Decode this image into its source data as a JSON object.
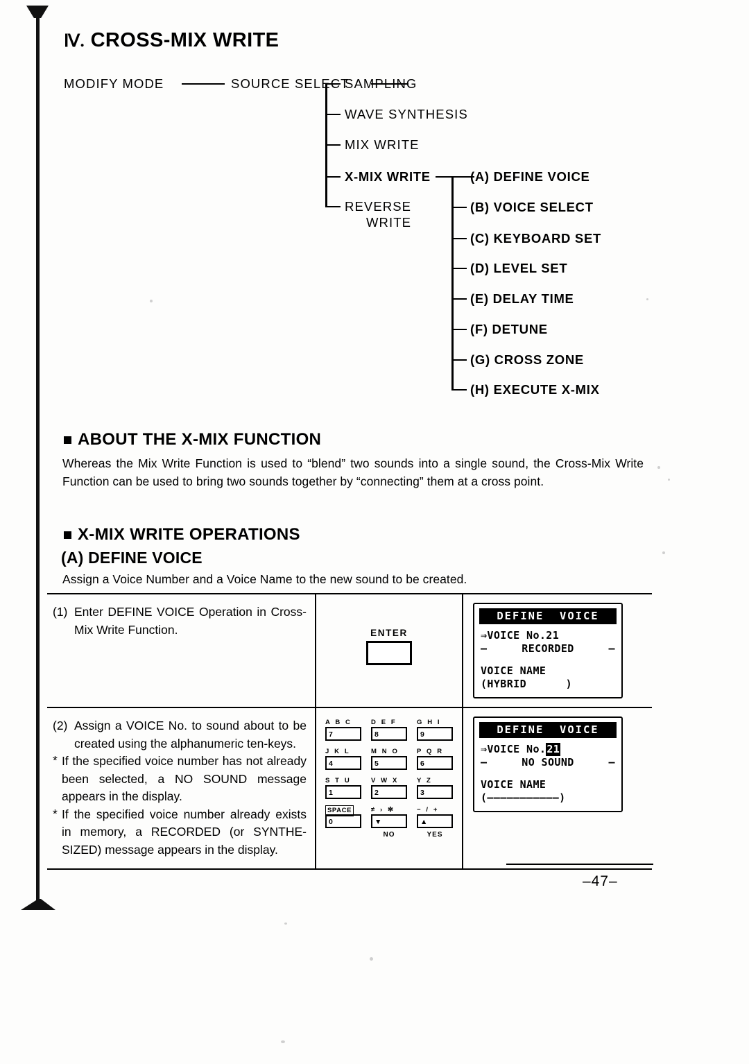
{
  "document": {
    "title_numeral": "Ⅳ.",
    "title": "CROSS-MIX WRITE",
    "page_number": "–47–"
  },
  "tree": {
    "root": "MODIFY MODE",
    "level2": "SOURCE SELECT",
    "branches": [
      "SAMPLING",
      "WAVE SYNTHESIS",
      "MIX WRITE",
      "X-MIX WRITE",
      "REVERSE"
    ],
    "reverse_second_line": "WRITE",
    "submenu": [
      "(A) DEFINE VOICE",
      "(B) VOICE SELECT",
      "(C) KEYBOARD SET",
      "(D) LEVEL SET",
      "(E) DELAY TIME",
      "(F) DETUNE",
      "(G) CROSS ZONE",
      "(H) EXECUTE X-MIX"
    ]
  },
  "about": {
    "heading": "ABOUT THE X-MIX FUNCTION",
    "paragraph": "Whereas the Mix Write Function is used to “blend” two sounds into a single sound, the Cross-Mix Write Function can be used to bring two sounds together by “connecting” them at a cross point."
  },
  "operations": {
    "heading": "X-MIX WRITE OPERATIONS",
    "subheading": "(A) DEFINE VOICE",
    "intro": "Assign a Voice Number and a Voice Name to the new sound to be created."
  },
  "steps": [
    {
      "number": "(1)",
      "text": "Enter DEFINE VOICE Operation in Cross-Mix Write Function.",
      "notes": []
    },
    {
      "number": "(2)",
      "text": "Assign a VOICE No. to sound about to be created using the alphanumeric ten-keys.",
      "notes": [
        "If the specified voice number has not already been selected, a NO SOUND message appears in the display.",
        "If the specified voice number already exists in memory, a RECORDED (or SYNTHE-SIZED) message appears in the display."
      ]
    }
  ],
  "enter_key": {
    "label": "ENTER"
  },
  "keypad": {
    "rows": [
      [
        {
          "caption": "A B C",
          "key": "7",
          "foot": ""
        },
        {
          "caption": "D E F",
          "key": "8",
          "foot": ""
        },
        {
          "caption": "G H I",
          "key": "9",
          "foot": ""
        }
      ],
      [
        {
          "caption": "J K L",
          "key": "4",
          "foot": ""
        },
        {
          "caption": "M N O",
          "key": "5",
          "foot": ""
        },
        {
          "caption": "P Q R",
          "key": "6",
          "foot": ""
        }
      ],
      [
        {
          "caption": "S T U",
          "key": "1",
          "foot": ""
        },
        {
          "caption": "V W X",
          "key": "2",
          "foot": ""
        },
        {
          "caption": "Y Z",
          "key": "3",
          "foot": ""
        }
      ],
      [
        {
          "caption": "SPACE",
          "key": "0",
          "foot": ""
        },
        {
          "caption": "≠ › ✻",
          "key": "▼",
          "foot": "NO"
        },
        {
          "caption": "− / +",
          "key": "▲",
          "foot": "YES"
        }
      ]
    ]
  },
  "displays": [
    {
      "title": "DEFINE  VOICE",
      "line1": "⇒VOICE No.21",
      "flank_left": "–",
      "flank_center": "RECORDED",
      "flank_right": "–",
      "line3": "VOICE NAME",
      "line4": "(HYBRID      )"
    },
    {
      "title": "DEFINE  VOICE",
      "line1_prefix": "⇒VOICE No.",
      "line1_blink": "21",
      "flank_left": "–",
      "flank_center": "NO SOUND",
      "flank_right": "–",
      "line3": "VOICE NAME",
      "line4": "(–––––––––––)"
    }
  ]
}
